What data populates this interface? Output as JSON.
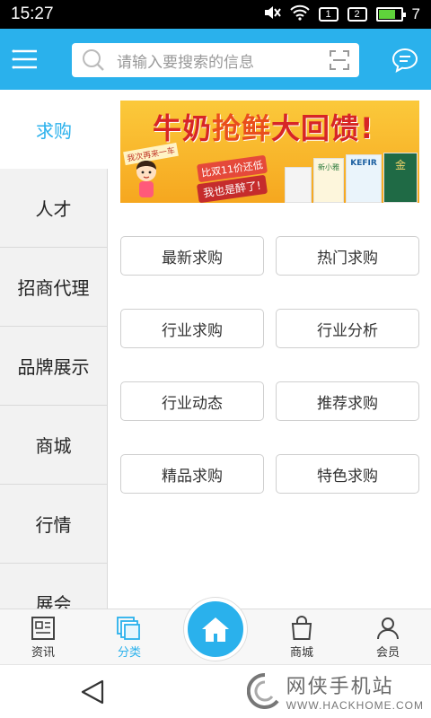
{
  "status_bar": {
    "time": "15:27",
    "sim1": "1",
    "sim2": "2",
    "battery_level": 0.75,
    "battery_text": "7"
  },
  "header": {
    "search_placeholder": "请输入要搜索的信息",
    "icons": [
      "menu-icon",
      "search-icon",
      "scan-icon",
      "message-icon"
    ]
  },
  "sidebar": {
    "items": [
      {
        "label": "求购",
        "active": true
      },
      {
        "label": "人才"
      },
      {
        "label": "招商代理"
      },
      {
        "label": "品牌展示"
      },
      {
        "label": "商城"
      },
      {
        "label": "行情"
      },
      {
        "label": "展会"
      }
    ]
  },
  "banner": {
    "title_part1": "牛奶",
    "title_part2": "抢鲜",
    "title_part3": "大回馈!",
    "sign_text": "我次再来一车",
    "sub_text": "比双11价还低",
    "sub_text2": "我也是醉了!",
    "product_label1": "新小雅",
    "product_label2": "KEFIR",
    "product_label3": "金"
  },
  "categories": [
    {
      "label": "最新求购"
    },
    {
      "label": "热门求购"
    },
    {
      "label": "行业求购"
    },
    {
      "label": "行业分析"
    },
    {
      "label": "行业动态"
    },
    {
      "label": "推荐求购"
    },
    {
      "label": "精品求购"
    },
    {
      "label": "特色求购"
    }
  ],
  "bottom_nav": {
    "items": [
      {
        "label": "资讯",
        "icon": "news-icon"
      },
      {
        "label": "分类",
        "icon": "category-icon",
        "active": true
      },
      {
        "label": "商城",
        "icon": "shopping-bag-icon"
      },
      {
        "label": "会员",
        "icon": "member-icon"
      }
    ],
    "home_icon": "home-icon"
  },
  "watermark": {
    "text": "网侠手机站",
    "url": "WWW.HACKHOME.COM"
  },
  "colors": {
    "primary": "#2ab1ec",
    "sidebar_bg": "#f2f2f2",
    "text": "#222222"
  }
}
